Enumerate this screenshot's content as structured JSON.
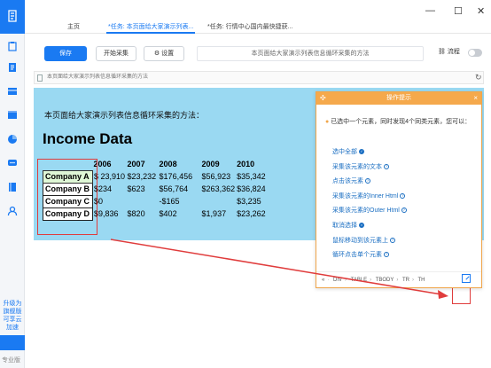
{
  "window": {
    "tabs": [
      {
        "label": "主页",
        "active": false
      },
      {
        "label": "*任务: 本页面给大家演示列表...",
        "active": true
      },
      {
        "label": "*任务: 行情中心国内最快捷获...",
        "active": false
      }
    ],
    "min_glyph": "—",
    "max_glyph": "☐",
    "close_glyph": "✕"
  },
  "toolbar": {
    "save_label": "保存",
    "start_label": "开始采集",
    "settings_label": "设置",
    "task_name": "本页面给大家演示列表信息循环采集的方法",
    "flow_label": "流程"
  },
  "urlbar": {
    "text": "本页面给大家演示列表信息循环采集的方法"
  },
  "sidebar": {
    "promo_text": "升级为旗舰版可享云加速",
    "edition_label": "专业版"
  },
  "page": {
    "intro": "本页面给大家演示列表信息循环采集的方法：",
    "heading": "Income Data",
    "years": [
      "2006",
      "2007",
      "2008",
      "2009",
      "2010"
    ],
    "rows": [
      {
        "company": "Company A",
        "values": [
          "$ 23,910",
          "$23,232",
          "$176,456",
          "$56,923",
          "$35,342"
        ]
      },
      {
        "company": "Company B",
        "values": [
          "$234",
          "$623",
          "$56,764",
          "$263,362",
          "$36,824"
        ]
      },
      {
        "company": "Company C",
        "values": [
          "$0",
          "",
          "-$165",
          "",
          "$3,235"
        ]
      },
      {
        "company": "Company D",
        "values": [
          "$9,836",
          "$820",
          "$402",
          "$1,937",
          "$23,262"
        ]
      }
    ]
  },
  "hint": {
    "title": "操作提示",
    "message": "已选中一个元素，同时发现4个同类元素，您可以：",
    "links": [
      {
        "label": "选中全部",
        "icon": "check-circle-icon"
      },
      {
        "label": "采集该元素的文本",
        "icon": "help-icon"
      },
      {
        "label": "点击该元素",
        "icon": "help-icon"
      },
      {
        "label": "采集该元素的Inner Html",
        "icon": "help-icon"
      },
      {
        "label": "采集该元素的Outer Html",
        "icon": "help-icon"
      },
      {
        "label": "取消选择",
        "icon": "close-circle-icon"
      },
      {
        "label": "鼠标移动到该元素上",
        "icon": "help-icon"
      },
      {
        "label": "循环点击单个元素",
        "icon": "help-icon"
      }
    ],
    "path": [
      "«",
      "DIV",
      "TABLE",
      "TBODY",
      "TR",
      "TH"
    ]
  },
  "colors": {
    "accent": "#1a7af2",
    "page_bg": "#9ad9f2",
    "hint_header": "#f5a94c",
    "annotation_red": "#e03c3c"
  }
}
